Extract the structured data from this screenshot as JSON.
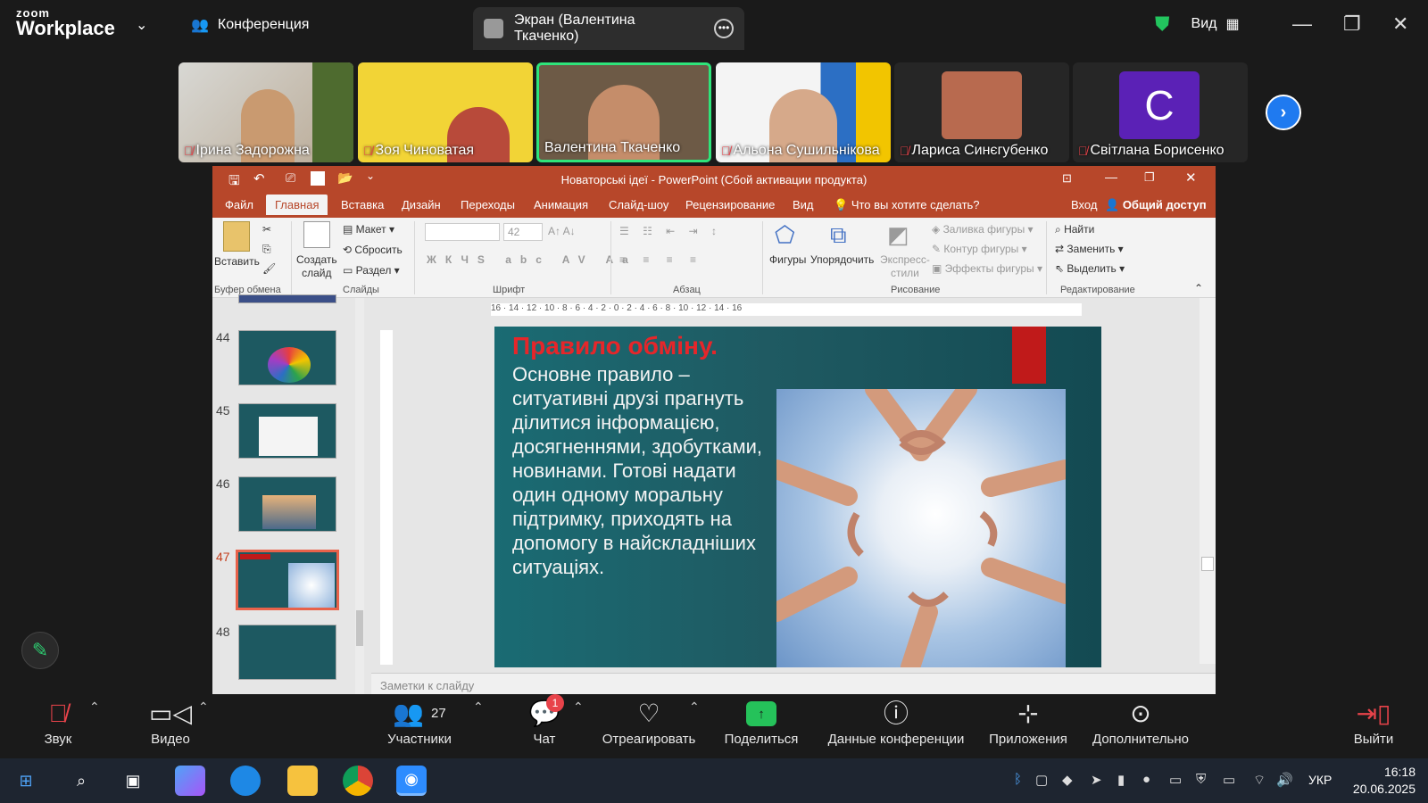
{
  "zoom": {
    "logo_top": "zoom",
    "logo_bottom": "Workplace",
    "meeting_label": "Конференция",
    "screen_share_label": "Экран (Валентина Ткаченко)",
    "view_label": "Вид",
    "participants_tiles": [
      {
        "name": "Ірина Задорожна",
        "muted": true
      },
      {
        "name": "Зоя Чиноватая",
        "muted": true
      },
      {
        "name": "Валентина Ткаченко",
        "muted": false
      },
      {
        "name": "Альона Сушильнікова",
        "muted": true
      },
      {
        "name": "Лариса Синєгубенко",
        "muted": true
      },
      {
        "name": "Світлана Борисенко",
        "muted": true
      }
    ],
    "avatar_letter": "C",
    "toolbar": {
      "audio": "Звук",
      "video": "Видео",
      "participants": "Участники",
      "participants_count": "27",
      "chat": "Чат",
      "chat_badge": "1",
      "react": "Отреагировать",
      "share": "Поделиться",
      "meeting_info": "Данные конференции",
      "apps": "Приложения",
      "more": "Дополнительно",
      "leave": "Выйти"
    }
  },
  "ppt": {
    "title": "Новаторські ідеї - PowerPoint (Сбой активации продукта)",
    "tabs": [
      "Файл",
      "Главная",
      "Вставка",
      "Дизайн",
      "Переходы",
      "Анимация",
      "Слайд-шоу",
      "Рецензирование",
      "Вид"
    ],
    "active_tab": "Главная",
    "tell_me": "Что вы хотите сделать?",
    "sign_in": "Вход",
    "share": "Общий доступ",
    "ribbon": {
      "paste": "Вставить",
      "clipboard_group": "Буфер обмена",
      "new_slide_1": "Создать",
      "new_slide_2": "слайд",
      "layout": "Макет",
      "reset": "Сбросить",
      "section": "Раздел",
      "slides_group": "Слайды",
      "font_size": "42",
      "font_group": "Шрифт",
      "paragraph_group": "Абзац",
      "shapes": "Фигуры",
      "arrange": "Упорядочить",
      "quick_styles_1": "Экспресс-",
      "quick_styles_2": "стили",
      "shape_fill": "Заливка фигуры",
      "shape_outline": "Контур фигуры",
      "shape_effects": "Эффекты фигуры",
      "drawing_group": "Рисование",
      "find": "Найти",
      "replace": "Заменить",
      "select": "Выделить",
      "editing_group": "Редактирование"
    },
    "ruler_h": "16 · 14 · 12 · 10 · 8 · 6 · 4 · 2 · 0 · 2 · 4 · 6 · 8 · 10 · 12 · 14 · 16",
    "thumbnails": [
      {
        "num": "44",
        "selected": false
      },
      {
        "num": "45",
        "selected": false
      },
      {
        "num": "46",
        "selected": false
      },
      {
        "num": "47",
        "selected": true
      },
      {
        "num": "48",
        "selected": false
      }
    ],
    "slide": {
      "title": "Правило обміну.",
      "body": "Основне правило – ситуативні друзі прагнуть ділитися інформацією, досягненнями, здобутками, новинами. Готові надати один одному моральну підтримку, приходять на допомогу в найскладніших ситуаціях."
    },
    "notes_placeholder": "Заметки к слайду"
  },
  "taskbar": {
    "lang": "УКР",
    "time": "16:18",
    "date": "20.06.2025"
  },
  "colors": {
    "ppt_accent": "#b7472a",
    "zoom_share_green": "#25c25a",
    "mute_red": "#e8434a",
    "slide_title_red": "#e6262a"
  }
}
